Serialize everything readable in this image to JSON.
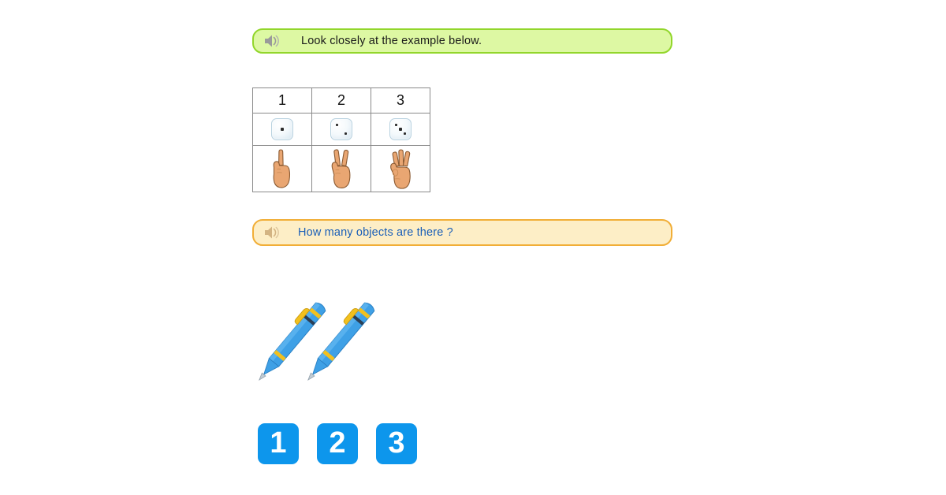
{
  "page": {
    "background_color": "#ffffff",
    "title": "How many objects are there ?"
  },
  "instruction_banner": {
    "text": "Look closely at the example below.",
    "icon": "speaker-icon",
    "background_color": "#ddf8a3",
    "border_color": "#92d62b",
    "text_color": "#1a1a1a"
  },
  "question_banner": {
    "text": "How many objects are there ?",
    "icon": "speaker-icon",
    "background_color": "#fdeec6",
    "border_color": "#f1ae37",
    "text_color": "#1a5fb8"
  },
  "example_table": {
    "border_color": "#8a8a8a",
    "columns": [
      {
        "number": "1",
        "dice_pips": 1,
        "hand_fingers": 1
      },
      {
        "number": "2",
        "dice_pips": 2,
        "hand_fingers": 2
      },
      {
        "number": "3",
        "dice_pips": 3,
        "hand_fingers": 3
      }
    ]
  },
  "objects_illustration": {
    "item": "pen",
    "count": 2,
    "body_color": "#3ea0e6",
    "accent_color": "#f2c01e",
    "tip_color": "#b9c3cb"
  },
  "answer_choices": {
    "accent_color": "#0d96ec",
    "text_color": "#ffffff",
    "options": [
      {
        "label": "1",
        "value": 1
      },
      {
        "label": "2",
        "value": 2
      },
      {
        "label": "3",
        "value": 3
      }
    ]
  }
}
